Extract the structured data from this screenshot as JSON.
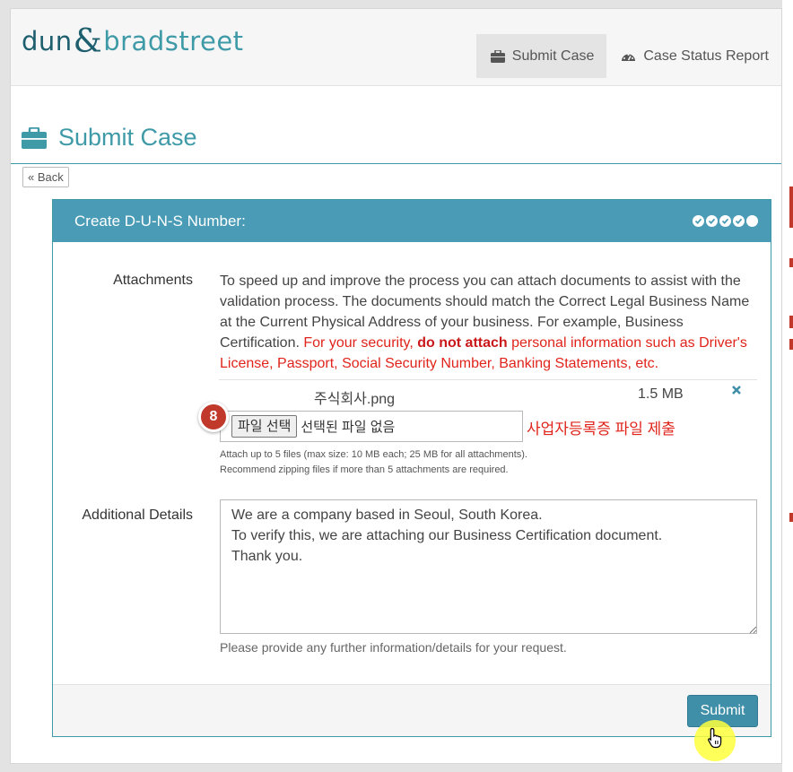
{
  "logo": {
    "part1": "dun",
    "amp": "&",
    "part2": "bradstreet"
  },
  "nav": {
    "submit_case": "Submit Case",
    "case_status": "Case Status Report"
  },
  "page": {
    "title": "Submit Case",
    "back": "« Back"
  },
  "panel": {
    "title": "Create D-U-N-S Number:",
    "attachments_label": "Attachments",
    "instructions": "To speed up and improve the process you can attach documents to assist with the validation process. The documents should match the Correct Legal Business Name at the Current Physical Address of your business. For example, Business Certification.",
    "security_pre": "For your security,",
    "security_bold": "do not attach",
    "security_post": "personal information such as Driver's License, Passport, Social Security Number, Banking Statements, etc.",
    "file": {
      "name": "주식회사.png",
      "size": "1.5 MB"
    },
    "file_input": {
      "button": "파일 선택",
      "status": "선택된 파일 없음"
    },
    "annotation_badge": "8",
    "annotation_text": "사업자등록증 파일 제출",
    "hint_line1": "Attach up to 5 files (max size: 10 MB each; 25 MB for all attachments).",
    "hint_line2": "Recommend zipping files if more than 5 attachments are required.",
    "details_label": "Additional Details",
    "details_text": "We are a company based in Seoul, South Korea.\nTo verify this, we are attaching our Business Certification document.\nThank you.",
    "details_help": "Please provide any further information/details for your request.",
    "submit": "Submit"
  },
  "colors": {
    "brand": "#3f9aa8",
    "header": "#4a9bb6",
    "warning": "#e0241b",
    "badge": "#c0392b"
  },
  "icons": [
    "briefcase-icon",
    "dashboard-icon",
    "check-circle-icon",
    "circle-icon",
    "close-icon",
    "resize-handle-icon",
    "hand-pointer-icon"
  ]
}
